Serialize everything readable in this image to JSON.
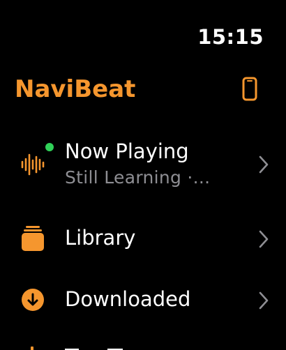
{
  "status": {
    "time": "15:15"
  },
  "app": {
    "title": "NaviBeat",
    "header_icon": "iphone-icon"
  },
  "colors": {
    "accent": "#f5962e",
    "background": "#000000",
    "primary_text": "#ffffff",
    "secondary_text": "#8e8e93",
    "live_indicator": "#30d158",
    "chevron": "#8e8e93"
  },
  "menu": {
    "items": [
      {
        "label": "Now Playing",
        "subtitle": "Still Learning ·...",
        "icon": "waveform-icon",
        "active_indicator": true
      },
      {
        "label": "Library",
        "icon": "stack-icon"
      },
      {
        "label": "Downloaded",
        "icon": "download-circle-icon"
      },
      {
        "label": "",
        "icon": "partial-icon"
      }
    ]
  }
}
